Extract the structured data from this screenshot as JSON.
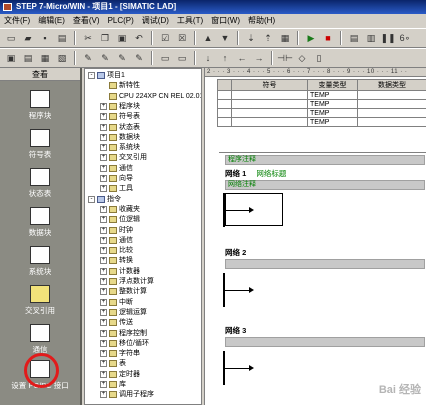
{
  "window": {
    "title": "STEP 7-Micro/WIN - 项目1 - [SIMATIC LAD]"
  },
  "menu": [
    "文件(F)",
    "编辑(E)",
    "查看(V)",
    "PLC(P)",
    "调试(D)",
    "工具(T)",
    "窗口(W)",
    "帮助(H)"
  ],
  "nav": {
    "title": "查看",
    "items": [
      "程序块",
      "符号表",
      "状态表",
      "数据块",
      "系统块",
      "交叉引用",
      "通信",
      "设置 PG/PC 接口"
    ]
  },
  "tree": [
    {
      "label": "项目1",
      "depth": 0,
      "pm": "-",
      "icon": "project-icon"
    },
    {
      "label": "新特性",
      "depth": 1,
      "pm": "",
      "icon": "info-icon"
    },
    {
      "label": "CPU 224XP CN REL 02.01",
      "depth": 1,
      "pm": "",
      "icon": "cpu-icon"
    },
    {
      "label": "程序块",
      "depth": 1,
      "pm": "+",
      "icon": "folder-icon"
    },
    {
      "label": "符号表",
      "depth": 1,
      "pm": "+",
      "icon": "folder-icon"
    },
    {
      "label": "状态表",
      "depth": 1,
      "pm": "+",
      "icon": "folder-icon"
    },
    {
      "label": "数据块",
      "depth": 1,
      "pm": "+",
      "icon": "folder-icon"
    },
    {
      "label": "系统块",
      "depth": 1,
      "pm": "+",
      "icon": "folder-icon"
    },
    {
      "label": "交叉引用",
      "depth": 1,
      "pm": "+",
      "icon": "folder-icon"
    },
    {
      "label": "通信",
      "depth": 1,
      "pm": "+",
      "icon": "folder-icon"
    },
    {
      "label": "向导",
      "depth": 1,
      "pm": "+",
      "icon": "folder-icon"
    },
    {
      "label": "工具",
      "depth": 1,
      "pm": "+",
      "icon": "folder-icon"
    },
    {
      "label": "指令",
      "depth": 0,
      "pm": "-",
      "icon": "instruction-icon"
    },
    {
      "label": "收藏夹",
      "depth": 1,
      "pm": "+",
      "icon": "folder-icon"
    },
    {
      "label": "位逻辑",
      "depth": 1,
      "pm": "+",
      "icon": "folder-icon"
    },
    {
      "label": "时钟",
      "depth": 1,
      "pm": "+",
      "icon": "folder-icon"
    },
    {
      "label": "通信",
      "depth": 1,
      "pm": "+",
      "icon": "folder-icon"
    },
    {
      "label": "比较",
      "depth": 1,
      "pm": "+",
      "icon": "folder-icon"
    },
    {
      "label": "转换",
      "depth": 1,
      "pm": "+",
      "icon": "folder-icon"
    },
    {
      "label": "计数器",
      "depth": 1,
      "pm": "+",
      "icon": "folder-icon"
    },
    {
      "label": "浮点数计算",
      "depth": 1,
      "pm": "+",
      "icon": "folder-icon"
    },
    {
      "label": "整数计算",
      "depth": 1,
      "pm": "+",
      "icon": "folder-icon"
    },
    {
      "label": "中断",
      "depth": 1,
      "pm": "+",
      "icon": "folder-icon"
    },
    {
      "label": "逻辑运算",
      "depth": 1,
      "pm": "+",
      "icon": "folder-icon"
    },
    {
      "label": "传送",
      "depth": 1,
      "pm": "+",
      "icon": "folder-icon"
    },
    {
      "label": "程序控制",
      "depth": 1,
      "pm": "+",
      "icon": "folder-icon"
    },
    {
      "label": "移位/循环",
      "depth": 1,
      "pm": "+",
      "icon": "folder-icon"
    },
    {
      "label": "字符串",
      "depth": 1,
      "pm": "+",
      "icon": "folder-icon"
    },
    {
      "label": "表",
      "depth": 1,
      "pm": "+",
      "icon": "folder-icon"
    },
    {
      "label": "定时器",
      "depth": 1,
      "pm": "+",
      "icon": "folder-icon"
    },
    {
      "label": "库",
      "depth": 1,
      "pm": "+",
      "icon": "library-icon"
    },
    {
      "label": "调用子程序",
      "depth": 1,
      "pm": "+",
      "icon": "folder-icon"
    }
  ],
  "editor": {
    "ruler": "2 · · · 3 · · · 4 · · · 5 · · · 6 · · · 7 · · · 8 · · · 9 · · · 10 · · · 11 · ·",
    "vartable": {
      "headers": [
        "",
        "符号",
        "变量类型",
        "数据类型"
      ],
      "rows": [
        [
          "",
          "",
          "TEMP",
          ""
        ],
        [
          "",
          "",
          "TEMP",
          ""
        ],
        [
          "",
          "",
          "TEMP",
          ""
        ],
        [
          "",
          "",
          "TEMP",
          ""
        ]
      ]
    },
    "program_comment": "程序注释",
    "networks": [
      {
        "label": "网络 1",
        "title": "网络标题",
        "comment": "网络注释"
      },
      {
        "label": "网络 2",
        "title": "",
        "comment": ""
      },
      {
        "label": "网络 3",
        "title": "",
        "comment": ""
      }
    ]
  },
  "watermark": "Bai 经验"
}
